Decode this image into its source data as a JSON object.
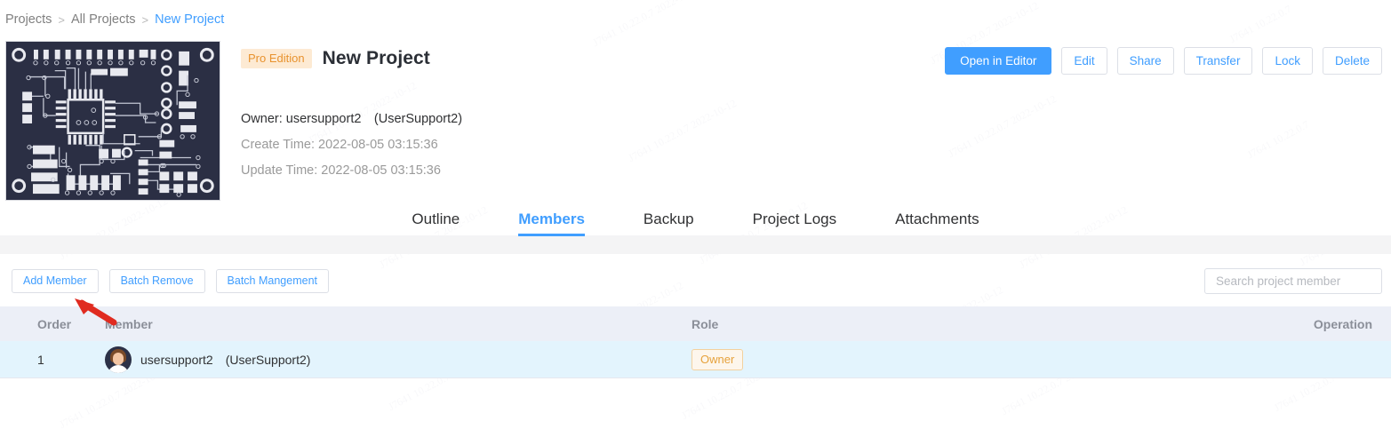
{
  "breadcrumb": {
    "items": [
      {
        "label": "Projects",
        "current": false
      },
      {
        "label": "All Projects",
        "current": false
      },
      {
        "label": "New Project",
        "current": true
      }
    ],
    "separator": ">"
  },
  "header": {
    "badge": "Pro Edition",
    "title": "New Project",
    "thumbnail_alt": "pcb-layout-thumbnail",
    "meta": {
      "owner_label": "Owner:",
      "owner_value": "usersupport2　(UserSupport2)",
      "create_label": "Create Time:",
      "create_value": "2022-08-05 03:15:36",
      "update_label": "Update Time:",
      "update_value": "2022-08-05 03:15:36"
    },
    "actions": [
      {
        "label": "Open in Editor",
        "primary": true
      },
      {
        "label": "Edit",
        "primary": false
      },
      {
        "label": "Share",
        "primary": false
      },
      {
        "label": "Transfer",
        "primary": false
      },
      {
        "label": "Lock",
        "primary": false
      },
      {
        "label": "Delete",
        "primary": false
      }
    ]
  },
  "tabs": [
    {
      "label": "Outline",
      "active": false
    },
    {
      "label": "Members",
      "active": true
    },
    {
      "label": "Backup",
      "active": false
    },
    {
      "label": "Project Logs",
      "active": false
    },
    {
      "label": "Attachments",
      "active": false
    }
  ],
  "toolbar": {
    "buttons": [
      {
        "label": "Add Member"
      },
      {
        "label": "Batch Remove"
      },
      {
        "label": "Batch Mangement"
      }
    ],
    "search_placeholder": "Search project member",
    "search_value": ""
  },
  "table": {
    "columns": [
      "Order",
      "Member",
      "Role",
      "Operation"
    ],
    "rows": [
      {
        "order": "1",
        "member": "usersupport2　(UserSupport2)",
        "role": "Owner",
        "operation": ""
      }
    ]
  },
  "colors": {
    "accent": "#409eff",
    "badge_bg": "#fdead3",
    "badge_text": "#e8922e",
    "owner_badge_bg": "#fdf6ec",
    "owner_badge_border": "#f3d19e",
    "owner_badge_text": "#e6a23c",
    "table_header_bg": "#eceff7",
    "table_row_bg": "#e3f4fd",
    "band_bg": "#f4f4f5",
    "annotation_arrow": "#e02b20"
  },
  "annotation": {
    "type": "arrow",
    "points_to": "order-column-header"
  }
}
